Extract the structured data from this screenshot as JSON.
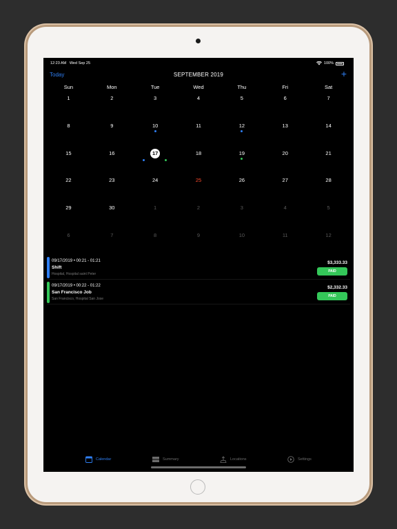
{
  "status_bar": {
    "time": "12:23 AM",
    "date": "Wed Sep 25",
    "battery": "100%"
  },
  "nav": {
    "today_label": "Today",
    "month_title": "SEPTEMBER 2019",
    "add_label": "+"
  },
  "calendar": {
    "weekdays": [
      "Sun",
      "Mon",
      "Tue",
      "Wed",
      "Thu",
      "Fri",
      "Sat"
    ],
    "weeks": [
      [
        "1",
        "2",
        "3",
        "4",
        "5",
        "6",
        "7"
      ],
      [
        "8",
        "9",
        "10",
        "11",
        "12",
        "13",
        "14"
      ],
      [
        "15",
        "16",
        "17",
        "18",
        "19",
        "20",
        "21"
      ],
      [
        "22",
        "23",
        "24",
        "25",
        "26",
        "27",
        "28"
      ],
      [
        "29",
        "30",
        "1",
        "2",
        "3",
        "4",
        "5"
      ],
      [
        "6",
        "7",
        "8",
        "9",
        "10",
        "11",
        "12"
      ]
    ],
    "selected_day": "17",
    "today_day": "25",
    "colors": {
      "accent": "#2f7ff3",
      "today": "#ff4a2d",
      "green": "#34c759"
    }
  },
  "events": [
    {
      "meta": "09/17/2019 • 00:21 - 01:21",
      "title": "Shift",
      "subtitle": "Hospital, Hospital saint Peter",
      "amount": "$3,333.33",
      "status": "PAID",
      "color": "#2f7ff3"
    },
    {
      "meta": "09/17/2019 • 00:22 - 01:22",
      "title": "San Francisco Job",
      "subtitle": "San Francisco, Hospital San Jose",
      "amount": "$2,332.33",
      "status": "PAID",
      "color": "#34c759"
    }
  ],
  "tabbar": {
    "calendar": "Calendar",
    "summary": "Summary",
    "locations": "Locations",
    "settings": "Settings"
  }
}
